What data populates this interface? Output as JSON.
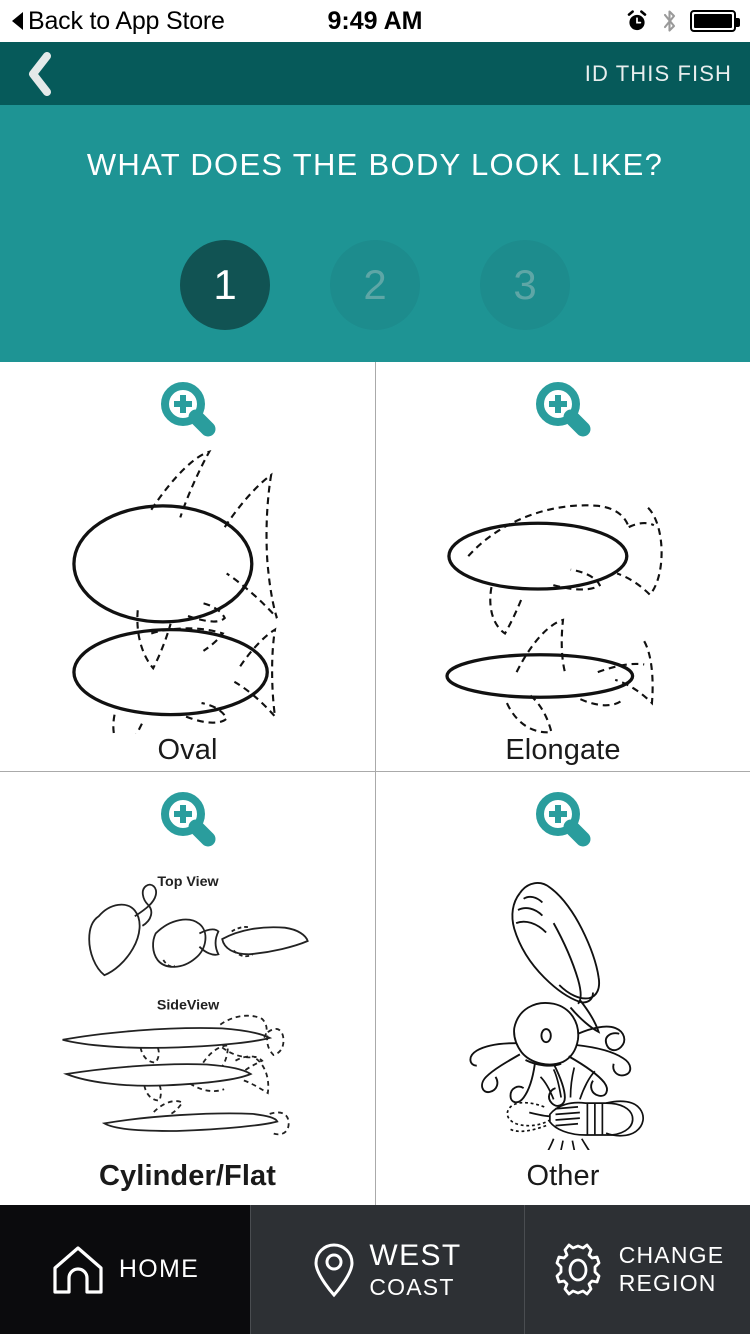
{
  "status_bar": {
    "back_label": "Back to App Store",
    "time": "9:49 AM",
    "icons": [
      "alarm-clock-icon",
      "bluetooth-icon",
      "battery-full-icon"
    ]
  },
  "nav_bar": {
    "back_icon": "chevron-left-icon",
    "title": "ID THIS FISH",
    "background": "#065a5a"
  },
  "question": {
    "text": "WHAT DOES THE BODY LOOK LIKE?",
    "background": "#1e9494",
    "steps": [
      {
        "label": "1",
        "state": "active"
      },
      {
        "label": "2",
        "state": "idle"
      },
      {
        "label": "3",
        "state": "idle"
      }
    ]
  },
  "options": [
    {
      "label": "Oval",
      "zoom_icon": "magnifier-plus-icon",
      "bold": false,
      "view_labels": []
    },
    {
      "label": "Elongate",
      "zoom_icon": "magnifier-plus-icon",
      "bold": false,
      "view_labels": []
    },
    {
      "label": "Cylinder/Flat",
      "zoom_icon": "magnifier-plus-icon",
      "bold": true,
      "view_labels": [
        "Top View",
        "SideView"
      ]
    },
    {
      "label": "Other",
      "zoom_icon": "magnifier-plus-icon",
      "bold": false,
      "view_labels": []
    }
  ],
  "tab_bar": {
    "home": {
      "label": "HOME",
      "icon": "home-icon",
      "active": true
    },
    "region": {
      "line1": "WEST",
      "line2": "COAST",
      "icon": "map-pin-icon"
    },
    "change": {
      "line1": "CHANGE",
      "line2": "REGION",
      "icon": "gear-icon"
    }
  },
  "colors": {
    "teal": "#1e9494",
    "dark_teal": "#065a5a",
    "step_active": "#115353",
    "tab_dark": "#0b0b0d",
    "tab_grey": "#2d3034"
  }
}
